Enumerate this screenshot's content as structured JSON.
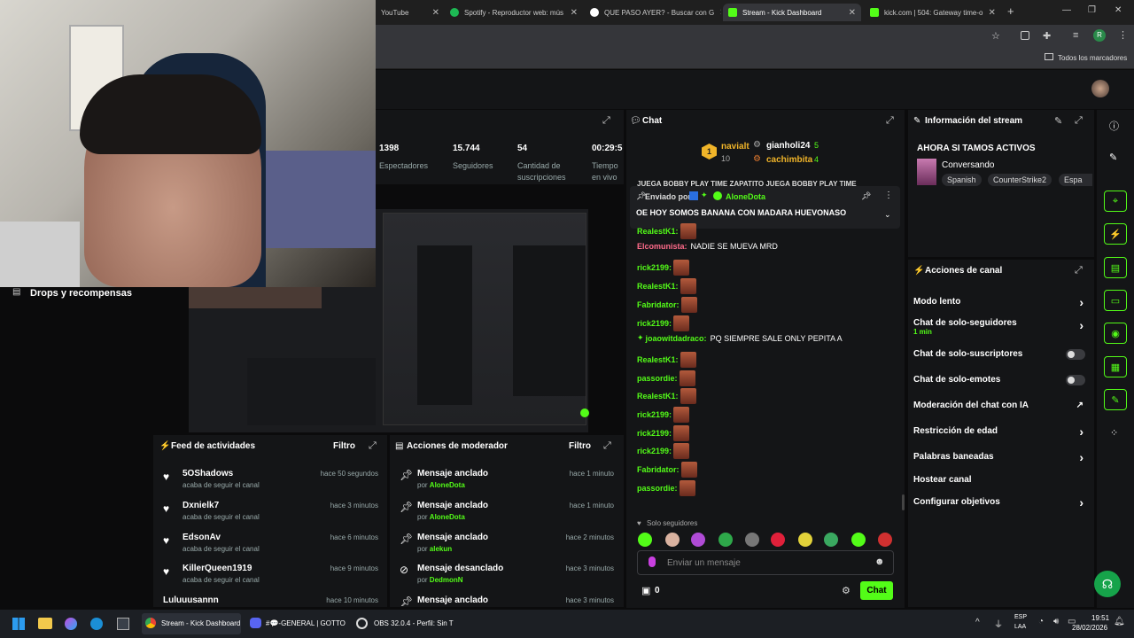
{
  "browser": {
    "tabs": [
      {
        "label": "YouTube",
        "color": "#ff0000"
      },
      {
        "label": "Spotify - Reproductor web: mús",
        "color": "#1db954"
      },
      {
        "label": "QUE PASO AYER? - Buscar con G",
        "color": "#4285f4"
      },
      {
        "label": "Stream - Kick Dashboard",
        "color": "#53fc18"
      },
      {
        "label": "kick.com | 504: Gateway time-o",
        "color": "#53fc18"
      }
    ],
    "new_tab": "+",
    "bookmarks_label": "Todos los marcadores",
    "profile_initial": "R"
  },
  "stats": [
    {
      "value": "1398",
      "label": "Espectadores"
    },
    {
      "value": "15.744",
      "label": "Seguidores"
    },
    {
      "value": "54",
      "label": "Cantidad de suscripciones"
    },
    {
      "value": "00:29:5",
      "label": "Tiempo en vivo"
    }
  ],
  "sidebar_left": {
    "drops": "Drops y recompensas"
  },
  "activity": {
    "title": "Feed de actividades",
    "filter": "Filtro",
    "items": [
      {
        "name": "5OShadows",
        "sub": "acaba de seguir el canal",
        "time": "hace 50 segundos"
      },
      {
        "name": "Dxnielk7",
        "sub": "acaba de seguir el canal",
        "time": "hace 3 minutos"
      },
      {
        "name": "EdsonAv",
        "sub": "acaba de seguir el canal",
        "time": "hace 6 minutos"
      },
      {
        "name": "KillerQueen1919",
        "sub": "acaba de seguir el canal",
        "time": "hace 9 minutos"
      },
      {
        "name": "Luluuusannn",
        "sub": "",
        "time": "hace 10 minutos"
      }
    ]
  },
  "modactions": {
    "title": "Acciones de moderador",
    "filter": "Filtro",
    "items": [
      {
        "action": "Mensaje anclado",
        "by_prefix": "por",
        "by": "AloneDota",
        "time": "hace 1 minuto"
      },
      {
        "action": "Mensaje anclado",
        "by_prefix": "por",
        "by": "AloneDota",
        "time": "hace 1 minuto"
      },
      {
        "action": "Mensaje anclado",
        "by_prefix": "por",
        "by": "alekun",
        "time": "hace 2 minutos"
      },
      {
        "action": "Mensaje desanclado",
        "by_prefix": "por",
        "by": "DedmonN",
        "time": "hace 3 minutos"
      },
      {
        "action": "Mensaje anclado",
        "by_prefix": "",
        "by": "",
        "time": "hace 3 minutos"
      }
    ]
  },
  "chat": {
    "title": "Chat",
    "leaderboard": [
      {
        "rank": "1",
        "name": "navialt",
        "count": "10"
      },
      {
        "name": "gianholi24",
        "count": "5"
      },
      {
        "name": "cachimbita",
        "count": "4"
      }
    ],
    "ticker": "JUEGA BOBBY PLAY TIME  ZAPATITO JUEGA BOBBY PLAY TIME",
    "pinned": {
      "label": "Enviado por",
      "user": "AloneDota",
      "text": "OE HOY SOMOS BANANA CON MADARA HUEVONASO"
    },
    "messages": [
      {
        "user": "RealestK1:",
        "color": "#53fc18",
        "text": "",
        "emote": true
      },
      {
        "user": "Elcomunista:",
        "color": "#ff6b8a",
        "text": "NADIE SE MUEVA MRD",
        "emote": false
      },
      {
        "user": "rick2199:",
        "color": "#53fc18",
        "text": "",
        "emote": true
      },
      {
        "user": "RealestK1:",
        "color": "#53fc18",
        "text": "",
        "emote": true
      },
      {
        "user": "Fabridator:",
        "color": "#53fc18",
        "text": "",
        "emote": true
      },
      {
        "user": "rick2199:",
        "color": "#53fc18",
        "text": "",
        "emote": true
      },
      {
        "user": "joaowitdadraco:",
        "color": "#53fc18",
        "text": "PQ SIEMPRE SALE ONLY PEPITA A",
        "emote": false
      },
      {
        "user": "RealestK1:",
        "color": "#53fc18",
        "text": "",
        "emote": true
      },
      {
        "user": "passordie:",
        "color": "#53fc18",
        "text": "",
        "emote": true
      },
      {
        "user": "RealestK1:",
        "color": "#53fc18",
        "text": "",
        "emote": true
      },
      {
        "user": "rick2199:",
        "color": "#53fc18",
        "text": "",
        "emote": true
      },
      {
        "user": "rick2199:",
        "color": "#53fc18",
        "text": "",
        "emote": true
      },
      {
        "user": "rick2199:",
        "color": "#53fc18",
        "text": "",
        "emote": true
      },
      {
        "user": "Fabridator:",
        "color": "#53fc18",
        "text": "",
        "emote": true
      },
      {
        "user": "passordie:",
        "color": "#53fc18",
        "text": "",
        "emote": true
      }
    ],
    "followers_only": "Solo seguidores",
    "placeholder": "Enviar un mensaje",
    "points": "0",
    "send": "Chat"
  },
  "streaminfo": {
    "title": "Información del stream",
    "stream_title": "AHORA SI TAMOS ACTIVOS",
    "category": "Conversando",
    "tags": [
      "Spanish",
      "CounterStrike2",
      "Espa"
    ]
  },
  "channel": {
    "title": "Acciones de canal",
    "slow": "Modo lento",
    "followers": "Chat de solo-seguidores",
    "followers_sub": "1 min",
    "subs": "Chat de solo-suscriptores",
    "emotes": "Chat de solo-emotes",
    "ai": "Moderación del chat con IA",
    "age": "Restricción de edad",
    "banned": "Palabras baneadas",
    "host": "Hostear canal",
    "goals": "Configurar objetivos"
  },
  "taskbar": {
    "items": [
      {
        "label": "Stream - Kick Dashboard"
      },
      {
        "label": "#💬-GENERAL | GOTTO"
      },
      {
        "label": "OBS 32.0.4 - Perfil: Sin T"
      }
    ],
    "lang": "ESP",
    "lang2": "LAA",
    "time": "19:51",
    "date": "28/02/2026"
  },
  "colors": {
    "accent": "#53fc18",
    "panel": "#141517",
    "bg": "#0b0b0c"
  }
}
